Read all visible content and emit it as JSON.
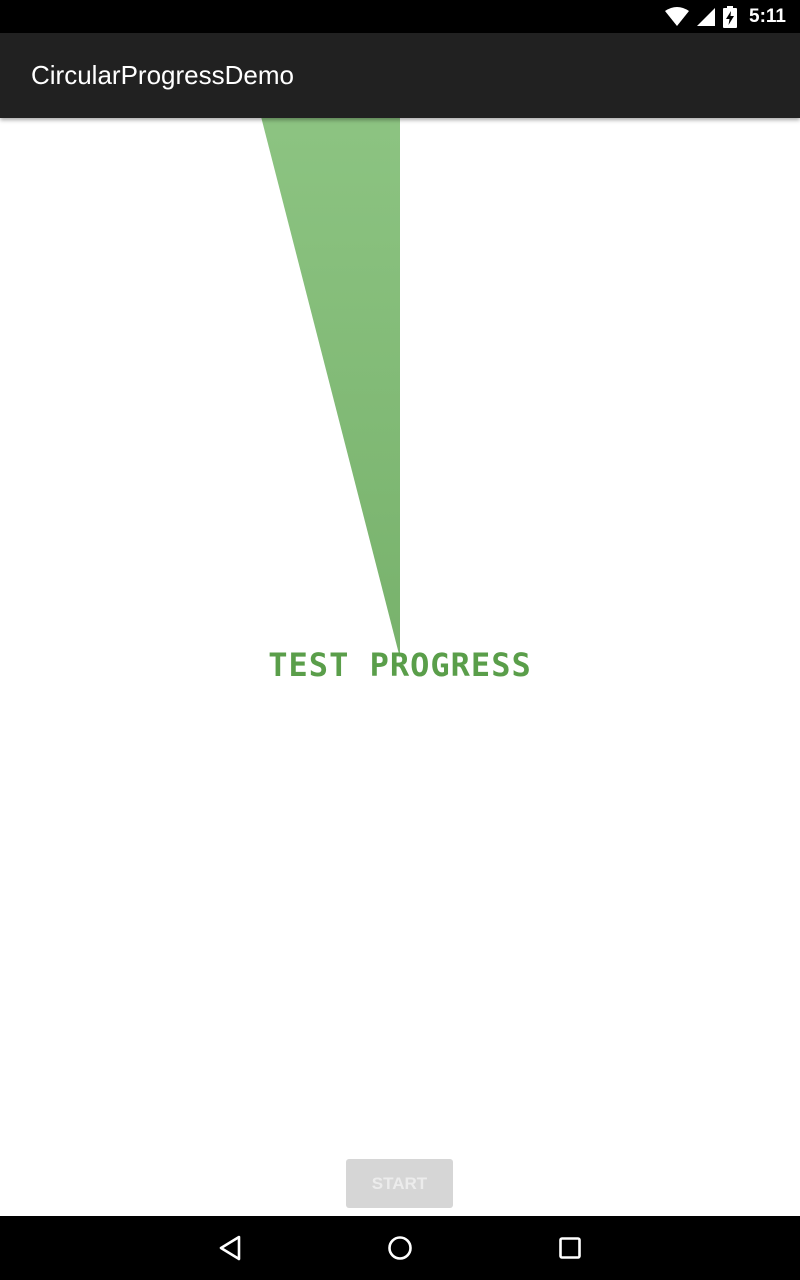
{
  "status_bar": {
    "time": "5:11",
    "icons": [
      "wifi-icon",
      "cell-signal-icon",
      "battery-charging-icon"
    ]
  },
  "app_bar": {
    "title": "CircularProgressDemo"
  },
  "progress": {
    "label": "TEST PROGRESS",
    "value_fraction": 0.04,
    "label_color": "#5a9e4a",
    "fill_color_light": "#a5d99c",
    "fill_color_dark": "#78b26c"
  },
  "start_button": {
    "label": "START",
    "enabled": false
  },
  "nav_bar": {
    "icons": [
      "back-icon",
      "home-icon",
      "recents-icon"
    ]
  }
}
